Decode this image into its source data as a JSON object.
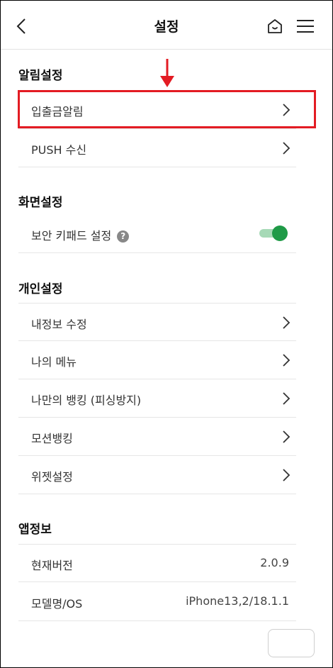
{
  "header": {
    "title": "설정",
    "back_icon": "chevron-left-icon",
    "home_icon": "home-icon",
    "menu_icon": "hamburger-menu-icon"
  },
  "sections": {
    "notifications": {
      "title": "알림설정",
      "items": [
        {
          "label": "입출금알림",
          "icon": "chevron-right-icon"
        },
        {
          "label": "PUSH 수신",
          "icon": "chevron-right-icon"
        }
      ]
    },
    "display": {
      "title": "화면설정",
      "items": [
        {
          "label": "보안 키패드 설정",
          "help": "?",
          "toggle_on": true
        }
      ]
    },
    "personal": {
      "title": "개인설정",
      "items": [
        {
          "label": "내정보 수정"
        },
        {
          "label": "나의 메뉴"
        },
        {
          "label": "나만의 뱅킹 (피싱방지)"
        },
        {
          "label": "모션뱅킹"
        },
        {
          "label": "위젯설정"
        }
      ]
    },
    "app_info": {
      "title": "앱정보",
      "items": [
        {
          "label": "현재버전",
          "value": "2.0.9"
        },
        {
          "label": "모델명/OS",
          "value": "iPhone13,2/18.1.1"
        }
      ]
    }
  },
  "colors": {
    "highlight": "#e31b23",
    "toggle_on": "#1f9a47",
    "toggle_track": "#a6d9b6"
  }
}
